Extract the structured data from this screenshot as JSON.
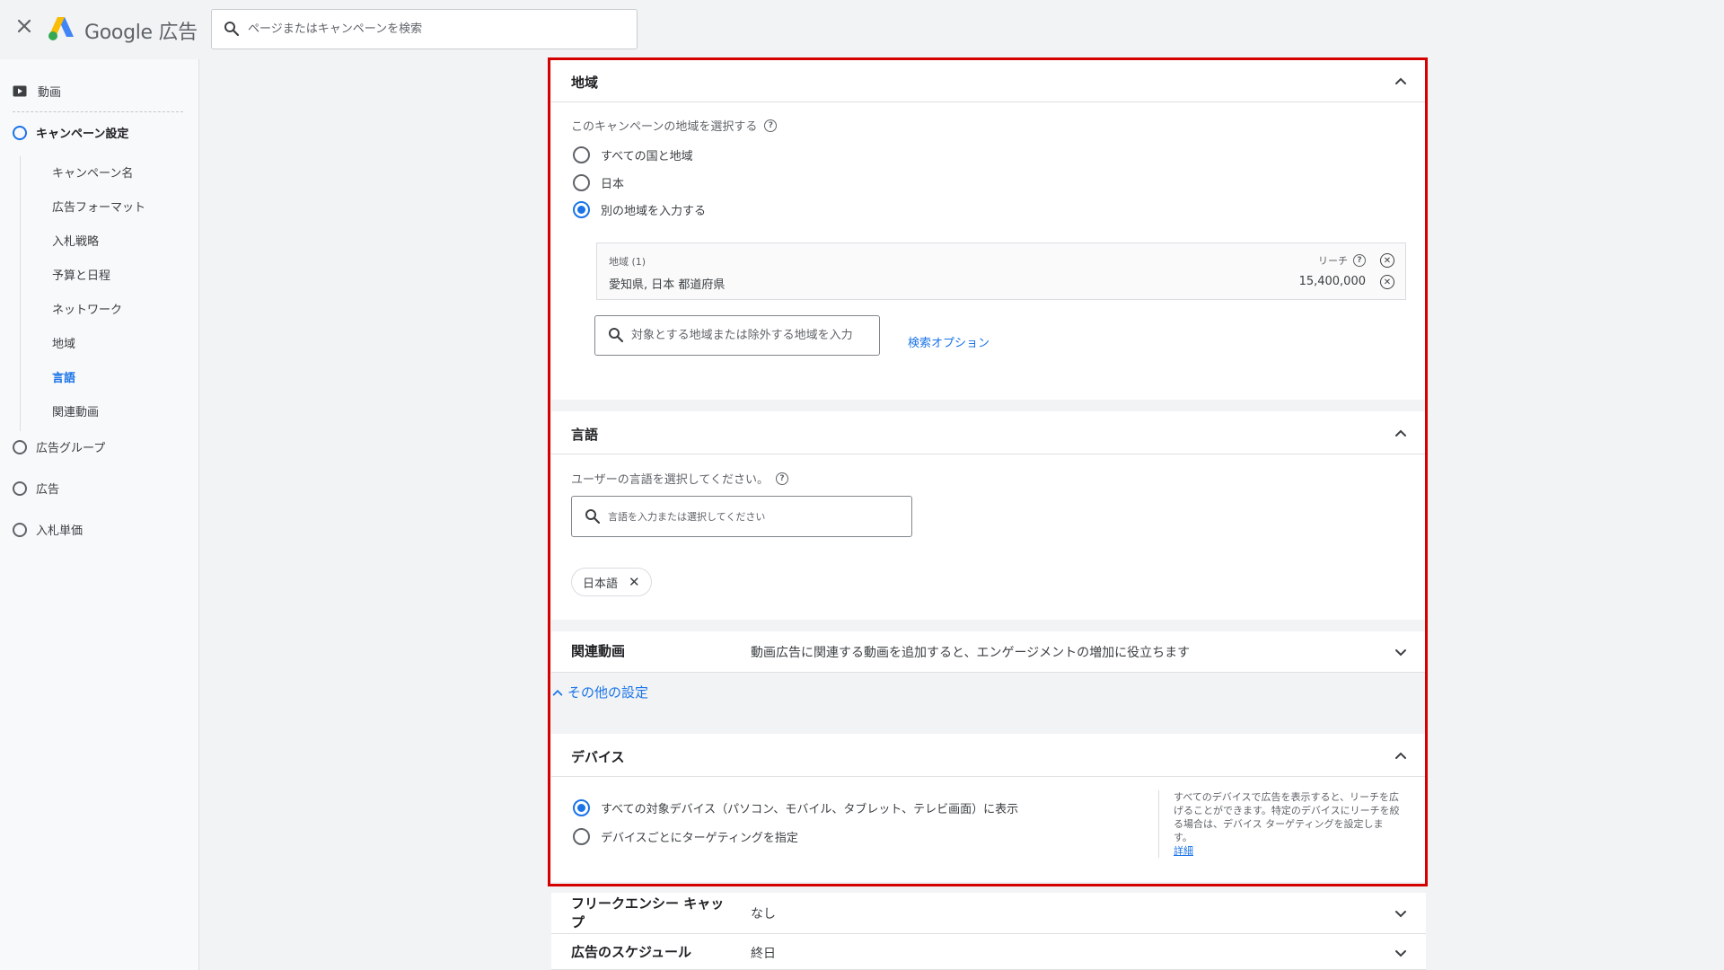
{
  "header": {
    "close_icon": "close-icon",
    "brand": "Google 広告",
    "search_placeholder": "ページまたはキャンペーンを検索"
  },
  "sidebar": {
    "video_label": "動画",
    "campaign_settings_label": "キャンペーン設定",
    "sub_items": [
      "キャンペーン名",
      "広告フォーマット",
      "入札戦略",
      "予算と日程",
      "ネットワーク",
      "地域",
      "言語",
      "関連動画"
    ],
    "current_sub_item": "言語",
    "ad_group_label": "広告グループ",
    "ad_label": "広告",
    "bid_label": "入札単価"
  },
  "location": {
    "title": "地域",
    "prompt": "このキャンペーンの地域を選択する",
    "options": [
      "すべての国と地域",
      "日本",
      "別の地域を入力する"
    ],
    "selected_option": "別の地域を入力する",
    "list_count": "地域 (1)",
    "reach_label": "リーチ",
    "item_name": "愛知県, 日本 都道府県",
    "item_reach": "15,400,000",
    "input_placeholder": "対象とする地域または除外する地域を入力",
    "search_options_link": "検索オプション"
  },
  "language": {
    "title": "言語",
    "prompt": "ユーザーの言語を選択してください。",
    "input_placeholder": "言語を入力または選択してください",
    "chip": "日本語"
  },
  "related_videos": {
    "title": "関連動画",
    "description": "動画広告に関連する動画を追加すると、エンゲージメントの増加に役立ちます"
  },
  "other_settings_link": "その他の設定",
  "devices": {
    "title": "デバイス",
    "options": [
      "すべての対象デバイス（パソコン、モバイル、タブレット、テレビ画面）に表示",
      "デバイスごとにターゲティングを指定"
    ],
    "selected_option": "すべての対象デバイス（パソコン、モバイル、タブレット、テレビ画面）に表示",
    "note": "すべてのデバイスで広告を表示すると、リーチを広げることができます。特定のデバイスにリーチを絞る場合は、デバイス ターゲティングを設定します。",
    "details_link": "詳細"
  },
  "frequency_cap": {
    "title": "フリークエンシー キャップ",
    "value": "なし"
  },
  "ad_schedule": {
    "title": "広告のスケジュール",
    "value": "終日"
  },
  "colors": {
    "accent": "#1a73e8",
    "highlight_frame": "#d50000"
  }
}
